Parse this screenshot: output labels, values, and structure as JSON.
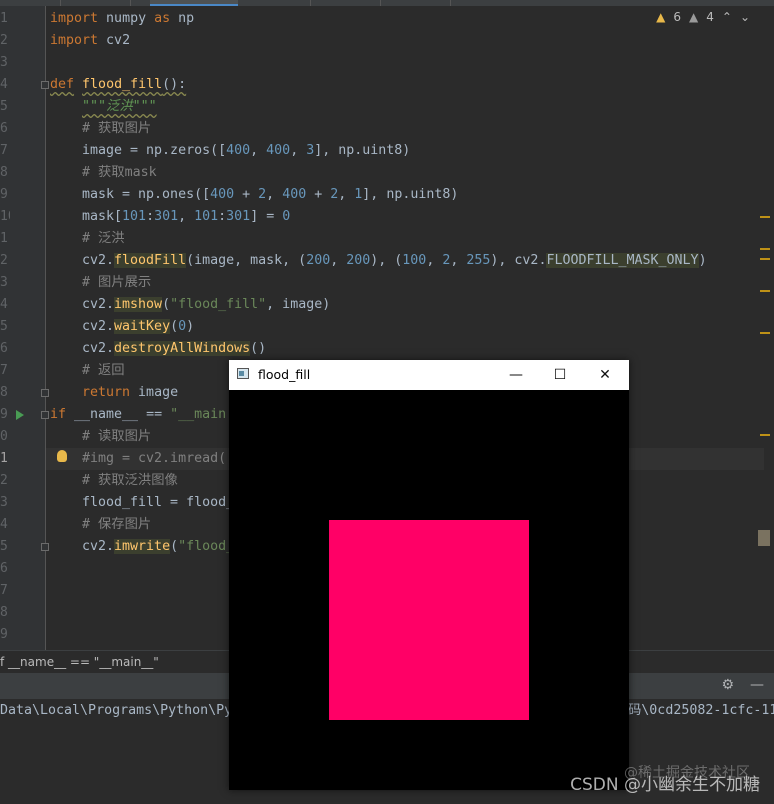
{
  "inspections": {
    "warning_count": "6",
    "weak_warning_count": "4"
  },
  "code_lines": [
    {
      "no": "1"
    },
    {
      "no": "2"
    },
    {
      "no": "3"
    },
    {
      "no": "4"
    },
    {
      "no": "5"
    },
    {
      "no": "6"
    },
    {
      "no": "7"
    },
    {
      "no": "8"
    },
    {
      "no": "9"
    },
    {
      "no": "10"
    },
    {
      "no": "1"
    },
    {
      "no": "2"
    },
    {
      "no": "3"
    },
    {
      "no": "4"
    },
    {
      "no": "5"
    },
    {
      "no": "6"
    },
    {
      "no": "7"
    },
    {
      "no": "8"
    },
    {
      "no": "9"
    },
    {
      "no": "0"
    },
    {
      "no": "1"
    },
    {
      "no": "2"
    },
    {
      "no": "3"
    },
    {
      "no": "4"
    },
    {
      "no": "5"
    },
    {
      "no": "6"
    },
    {
      "no": "7"
    },
    {
      "no": "8"
    },
    {
      "no": "9"
    }
  ],
  "code": {
    "l1_kw1": "import",
    "l1_mod": " numpy ",
    "l1_kw2": "as",
    "l1_alias": " np",
    "l2_kw": "import",
    "l2_mod": " cv2",
    "l4_kw": "def",
    "l4_name": "flood_fill",
    "l4_rest": "():",
    "l5_doc": "\"\"\"泛洪\"\"\"",
    "l6_com": "# 获取图片",
    "l7_a": "image = np.zeros([",
    "l7_n1": "400",
    "l7_c1": ", ",
    "l7_n2": "400",
    "l7_c2": ", ",
    "l7_n3": "3",
    "l7_b": "], np.uint8)",
    "l8_com": "# 获取mask",
    "l9_a": "mask = np.ones([",
    "l9_n1": "400",
    "l9_p1": " + ",
    "l9_n2": "2",
    "l9_c1": ", ",
    "l9_n3": "400",
    "l9_p2": " + ",
    "l9_n4": "2",
    "l9_c2": ", ",
    "l9_n5": "1",
    "l9_b": "], np.uint8)",
    "l10_a": "mask[",
    "l10_n1": "101",
    "l10_s1": ":",
    "l10_n2": "301",
    "l10_c": ", ",
    "l10_n3": "101",
    "l10_s2": ":",
    "l10_n4": "301",
    "l10_b": "] = ",
    "l10_n5": "0",
    "l11_com": "# 泛洪",
    "l12_a": "cv2.",
    "l12_fn": "floodFill",
    "l12_b": "(image, mask, (",
    "l12_n1": "200",
    "l12_c1": ", ",
    "l12_n2": "200",
    "l12_c2": "), (",
    "l12_n3": "100",
    "l12_c3": ", ",
    "l12_n4": "2",
    "l12_c4": ", ",
    "l12_n5": "255",
    "l12_c5": "), cv2.",
    "l12_const": "FLOODFILL_MASK_ONLY",
    "l12_e": ")",
    "l13_com": "# 图片展示",
    "l14_a": "cv2.",
    "l14_fn": "imshow",
    "l14_b": "(",
    "l14_s": "\"flood_fill\"",
    "l14_e": ", image)",
    "l15_a": "cv2.",
    "l15_fn": "waitKey",
    "l15_b": "(",
    "l15_n": "0",
    "l15_e": ")",
    "l16_a": "cv2.",
    "l16_fn": "destroyAllWindows",
    "l16_e": "()",
    "l17_com": "# 返回",
    "l18_kw": "return",
    "l18_rest": " image",
    "l19_kw": "if",
    "l19_a": " __name__ == ",
    "l19_s": "\"__main",
    "l20_com": "# 读取图片",
    "l21_com": "#img = cv2.imread(",
    "l22_com": "# 获取泛洪图像",
    "l23_a": "flood_fill = flood_",
    "l24_com": "# 保存图片",
    "l25_a": "cv2.",
    "l25_fn": "imwrite",
    "l25_b": "(",
    "l25_s": "\"flood_"
  },
  "breadcrumb": "f __name__ == \"__main__\"",
  "run": {
    "path_left": "Data\\Local\\Programs\\Python\\Py",
    "path_right": "码\\0cd25082-1cfc-11",
    "settings_icon": "gear-icon",
    "hide_icon": "minus-icon"
  },
  "cv_window": {
    "title": "flood_fill",
    "min_glyph": "—",
    "max_glyph": "☐",
    "close_glyph": "✕",
    "fill_color": "#ff0066",
    "background": "#000000"
  },
  "watermark": {
    "main": "CSDN @小幽余生不加糖",
    "sub": "@稀土掘金技术社区"
  }
}
